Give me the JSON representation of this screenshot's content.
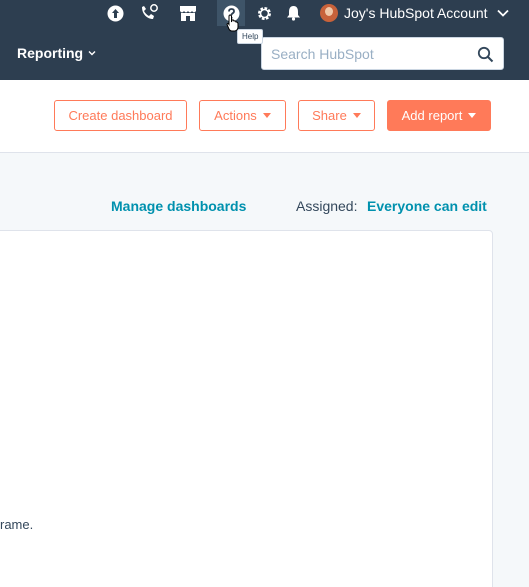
{
  "topbar": {
    "icons": [
      "upgrade-arrow-icon",
      "calling-icon",
      "marketplace-icon",
      "help-icon",
      "settings-gear-icon",
      "notifications-bell-icon"
    ],
    "account_name": "Joy's HubSpot Account",
    "help_tooltip": "Help"
  },
  "nav": {
    "reporting_label": "Reporting",
    "search_placeholder": "Search HubSpot"
  },
  "actions": {
    "create_dashboard": "Create dashboard",
    "actions": "Actions",
    "share": "Share",
    "add_report": "Add report"
  },
  "dashboard": {
    "manage_link": "Manage dashboards",
    "assigned_label": "Assigned:",
    "assigned_value": "Everyone can edit",
    "partial_text": "rame."
  },
  "colors": {
    "nav_bg": "#2d3e50",
    "accent": "#ff7a59",
    "link": "#0091ae"
  }
}
